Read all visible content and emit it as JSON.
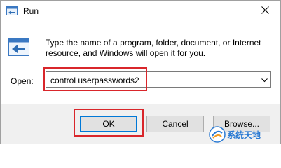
{
  "window": {
    "title": "Run"
  },
  "content": {
    "description_line1": "Type the name of a program, folder, document, or Internet",
    "description_line2": "resource, and Windows will open it for you.",
    "open_label_underlined": "O",
    "open_label_rest": "pen:",
    "command_value": "control userpasswords2"
  },
  "buttons": {
    "ok": "OK",
    "cancel": "Cancel",
    "browse": "Browse..."
  },
  "watermark": {
    "text": "系统天地"
  },
  "icons": {
    "title": "run-app-icon",
    "dialog": "run-app-icon",
    "close": "close-icon",
    "dropdown": "chevron-down-icon"
  },
  "colors": {
    "highlight": "#d9262b",
    "accent": "#0078d7",
    "footer_bg": "#f0f0f0"
  }
}
